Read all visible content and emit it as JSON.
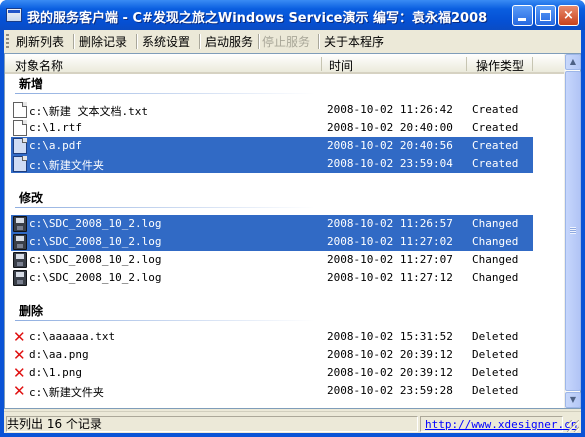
{
  "window": {
    "title": "我的服务客户端 - C#发现之旅之Windows Service演示 编写：袁永福2008",
    "controls": {
      "minimize": "minimize",
      "maximize": "maximize",
      "close": "×"
    }
  },
  "toolbar": {
    "items": [
      {
        "label": "刷新列表",
        "enabled": true
      },
      {
        "label": "删除记录",
        "enabled": true
      },
      {
        "label": "系统设置",
        "enabled": true
      },
      {
        "label": "启动服务",
        "enabled": true
      },
      {
        "label": "停止服务",
        "enabled": false
      },
      {
        "label": "关于本程序",
        "enabled": true
      }
    ]
  },
  "list": {
    "columns": [
      "对象名称",
      "时间",
      "操作类型"
    ],
    "groups": [
      {
        "title": "新增",
        "rows": [
          {
            "icon": "document-icon",
            "name": "c:\\新建 文本文档.txt",
            "time": "2008-10-02 11:26:42",
            "type": "Created",
            "selected": false
          },
          {
            "icon": "document-icon",
            "name": "c:\\1.rtf",
            "time": "2008-10-02 20:40:00",
            "type": "Created",
            "selected": false
          },
          {
            "icon": "document-icon",
            "name": "c:\\a.pdf",
            "time": "2008-10-02 20:40:56",
            "type": "Created",
            "selected": true
          },
          {
            "icon": "document-icon",
            "name": "c:\\新建文件夹",
            "time": "2008-10-02 23:59:04",
            "type": "Created",
            "selected": true
          }
        ]
      },
      {
        "title": "修改",
        "rows": [
          {
            "icon": "floppy-disk-icon",
            "name": "c:\\SDC_2008_10_2.log",
            "time": "2008-10-02 11:26:57",
            "type": "Changed",
            "selected": true
          },
          {
            "icon": "floppy-disk-icon",
            "name": "c:\\SDC_2008_10_2.log",
            "time": "2008-10-02 11:27:02",
            "type": "Changed",
            "selected": true
          },
          {
            "icon": "floppy-disk-icon",
            "name": "c:\\SDC_2008_10_2.log",
            "time": "2008-10-02 11:27:07",
            "type": "Changed",
            "selected": false
          },
          {
            "icon": "floppy-disk-icon",
            "name": "c:\\SDC_2008_10_2.log",
            "time": "2008-10-02 11:27:12",
            "type": "Changed",
            "selected": false
          }
        ]
      },
      {
        "title": "删除",
        "rows": [
          {
            "icon": "delete-x-icon",
            "name": "c:\\aaaaaa.txt",
            "time": "2008-10-02 15:31:52",
            "type": "Deleted",
            "selected": false
          },
          {
            "icon": "delete-x-icon",
            "name": "d:\\aa.png",
            "time": "2008-10-02 20:39:12",
            "type": "Deleted",
            "selected": false
          },
          {
            "icon": "delete-x-icon",
            "name": "d:\\1.png",
            "time": "2008-10-02 20:39:12",
            "type": "Deleted",
            "selected": false
          },
          {
            "icon": "delete-x-icon",
            "name": "c:\\新建文件夹",
            "time": "2008-10-02 23:59:28",
            "type": "Deleted",
            "selected": false
          }
        ]
      }
    ]
  },
  "status": {
    "count_text": "共列出 16 个记录",
    "link": "http://www.xdesigner.cn"
  },
  "colors": {
    "title_bar": "#0550d4",
    "selection": "#316ac5",
    "client": "#ece9d8",
    "delete_icon": "#e01010",
    "link": "#0000ff"
  }
}
